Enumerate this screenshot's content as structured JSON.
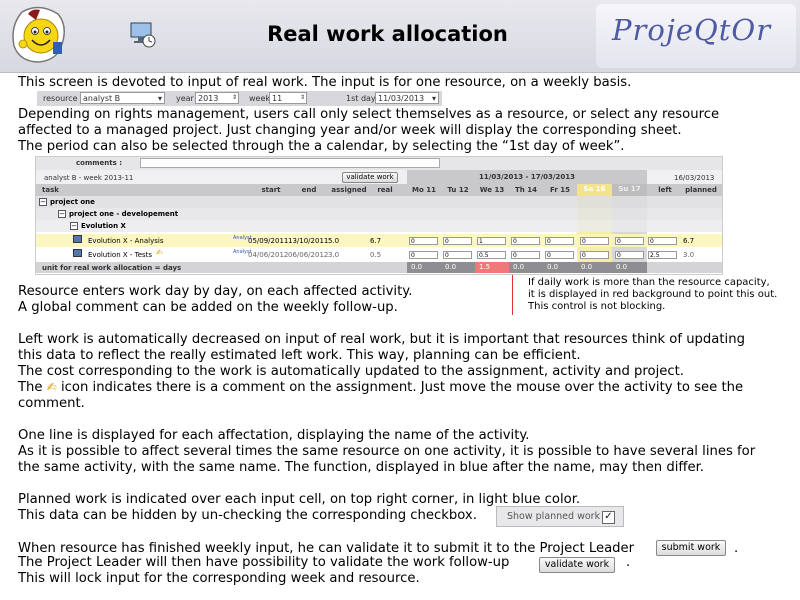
{
  "header": {
    "title": "Real work allocation",
    "brand": "ProjeQtOr"
  },
  "intro": {
    "line1": "This screen is devoted to input of real work. The input is for one resource, on a weekly basis.",
    "line2": "Depending on rights management, users call only select themselves as a resource, or select any resource",
    "line3": "affected to a managed project. Just changing year and/or week will display the corresponding sheet.",
    "line4": "The period can also be selected through the a calendar, by selecting the “1st day of week”."
  },
  "filters": {
    "resource_label": "resource",
    "resource_value": "analyst B",
    "year_label": "year",
    "year_value": "2013",
    "week_label": "week",
    "week_value": "11",
    "firstday_label": "1st day",
    "firstday_value": "11/03/2013"
  },
  "sheet": {
    "comments_label": "comments :",
    "week_title": "analyst B - week 2013-11",
    "validate_label": "validate work",
    "period": "11/03/2013 - 17/03/2013",
    "validated_date": "16/03/2013",
    "columns": {
      "task": "task",
      "start": "start",
      "end": "end",
      "assigned": "assigned",
      "real": "real",
      "left": "left",
      "planned": "planned"
    },
    "days": [
      "Mo 11",
      "Tu 12",
      "We 13",
      "Th 14",
      "Fr 15",
      "Sa 16",
      "Su 17"
    ],
    "rows": {
      "p1": "project one",
      "p2": "project one - developement",
      "p3": "Evolution X",
      "a1": {
        "name": "Evolution X - Analysis",
        "func": "Analyst",
        "start": "05/09/2011",
        "end": "13/10/2011",
        "assigned": "5.0",
        "real": "6.7",
        "inputs": [
          "0",
          "0",
          "1",
          "0",
          "0",
          "0",
          "0"
        ],
        "left": "0",
        "planned": "6.7"
      },
      "a2": {
        "name": "Evolution X - Tests",
        "func": "Analyst",
        "start": "04/06/2012",
        "end": "06/06/2012",
        "assigned": "3.0",
        "real": "0.5",
        "inputs": [
          "0",
          "0",
          "0.5",
          "0",
          "0",
          "0",
          "0"
        ],
        "left": "2.5",
        "planned": "3.0"
      }
    },
    "footer_label": "unit for real work allocation = days",
    "totals": [
      "0.0",
      "0.0",
      "1.5",
      "0.0",
      "0.0",
      "0.0",
      "0.0"
    ]
  },
  "annotation": {
    "line1": "If daily work is more than the resource capacity,",
    "line2": "it is displayed in red background to point this out.",
    "line3": "This control is not blocking."
  },
  "body": {
    "p1a": "Resource enters work day by day, on each affected activity.",
    "p1b": "A global comment can be added on the weekly follow-up.",
    "p2a": "Left work is automatically decreased on input of real work, but it is important that resources think of updating",
    "p2b": "this data to reflect the really estimated left work. This way, planning can be efficient.",
    "p2c": "The cost corresponding to the work is automatically updated to the assignment, activity and project.",
    "p2d_pre": "The",
    "p2d_post": "icon indicates there is a comment on the assignment. Just move the mouse over the activity to see the",
    "p2e": "comment.",
    "p3a": "One line is displayed for each affectation, displaying the name of the activity.",
    "p3b": "As it is possible to affect several times the same resource on one activity, it is possible to have several lines for",
    "p3c": "the same activity, with the same name. The function, displayed in blue after the name, may then differ.",
    "p4a": "Planned work is indicated over each input cell, on top right corner, in light blue color.",
    "p4b": "This data can be hidden by un-checking the corresponding checkbox.",
    "show_planned_label": "Show planned work",
    "p5a": "When resource has finished weekly input, he can validate it to submit it to the Project Leader",
    "submit_label": "submit work",
    "p5b": "The Project Leader will then have possibility to validate the work follow-up",
    "validate_label": "validate work",
    "p5c": "This will lock input for the corresponding week and resource.",
    "dot": "."
  }
}
